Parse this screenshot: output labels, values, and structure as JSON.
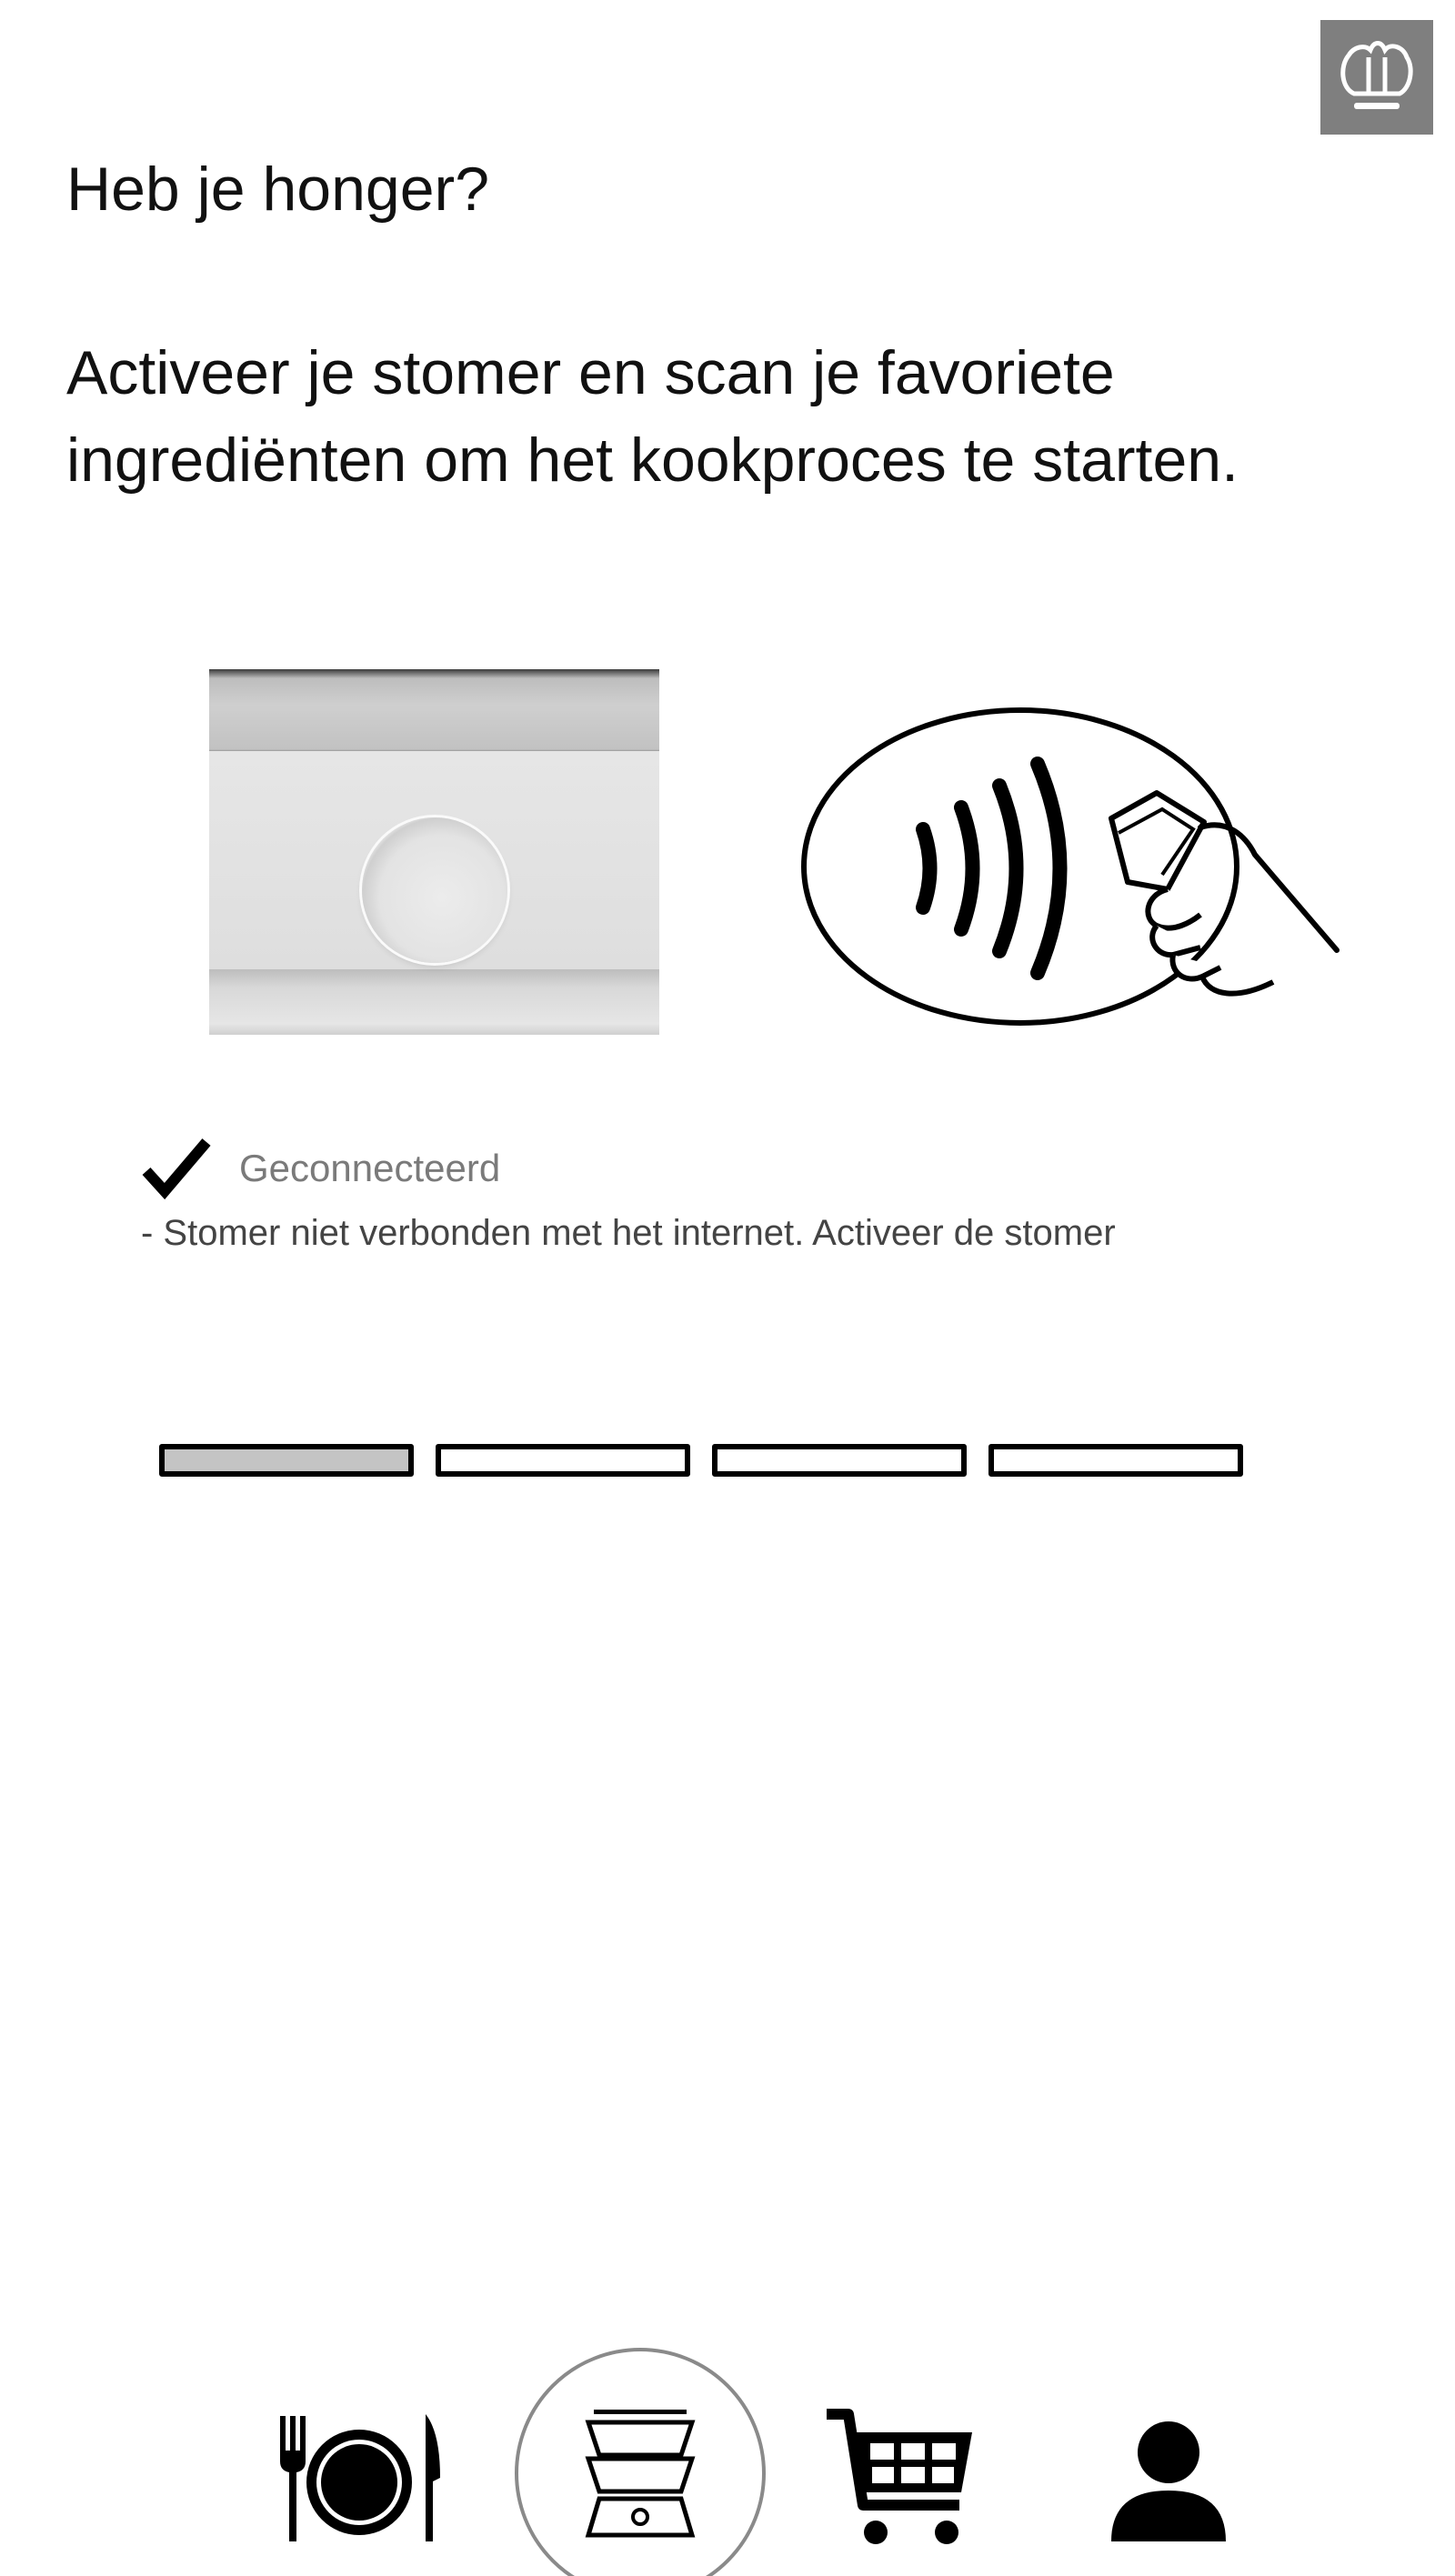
{
  "header": {
    "logo_icon": "chef-hat-icon",
    "logo_bg_color": "#7f7f7f"
  },
  "main": {
    "greeting": "Heb je honger?",
    "instruction": "Activeer je stomer en scan je favoriete ingrediënten om het kookproces te starten."
  },
  "illustrations": {
    "steamer_photo": "steamer-power-button-image",
    "nfc_graphic": "contactless-scan-icon"
  },
  "status": {
    "icon": "checkmark-icon",
    "label": "Geconnecteerd",
    "detail": "- Stomer niet verbonden met het internet. Activeer de stomer"
  },
  "progress": {
    "total_steps": 4,
    "current_step": 1,
    "filled_color": "#c4c4c4"
  },
  "bottom_nav": {
    "items": [
      {
        "icon": "dining-icon",
        "active": false
      },
      {
        "icon": "steamer-icon",
        "active": true
      },
      {
        "icon": "cart-icon",
        "active": false
      },
      {
        "icon": "profile-icon",
        "active": false
      }
    ]
  }
}
